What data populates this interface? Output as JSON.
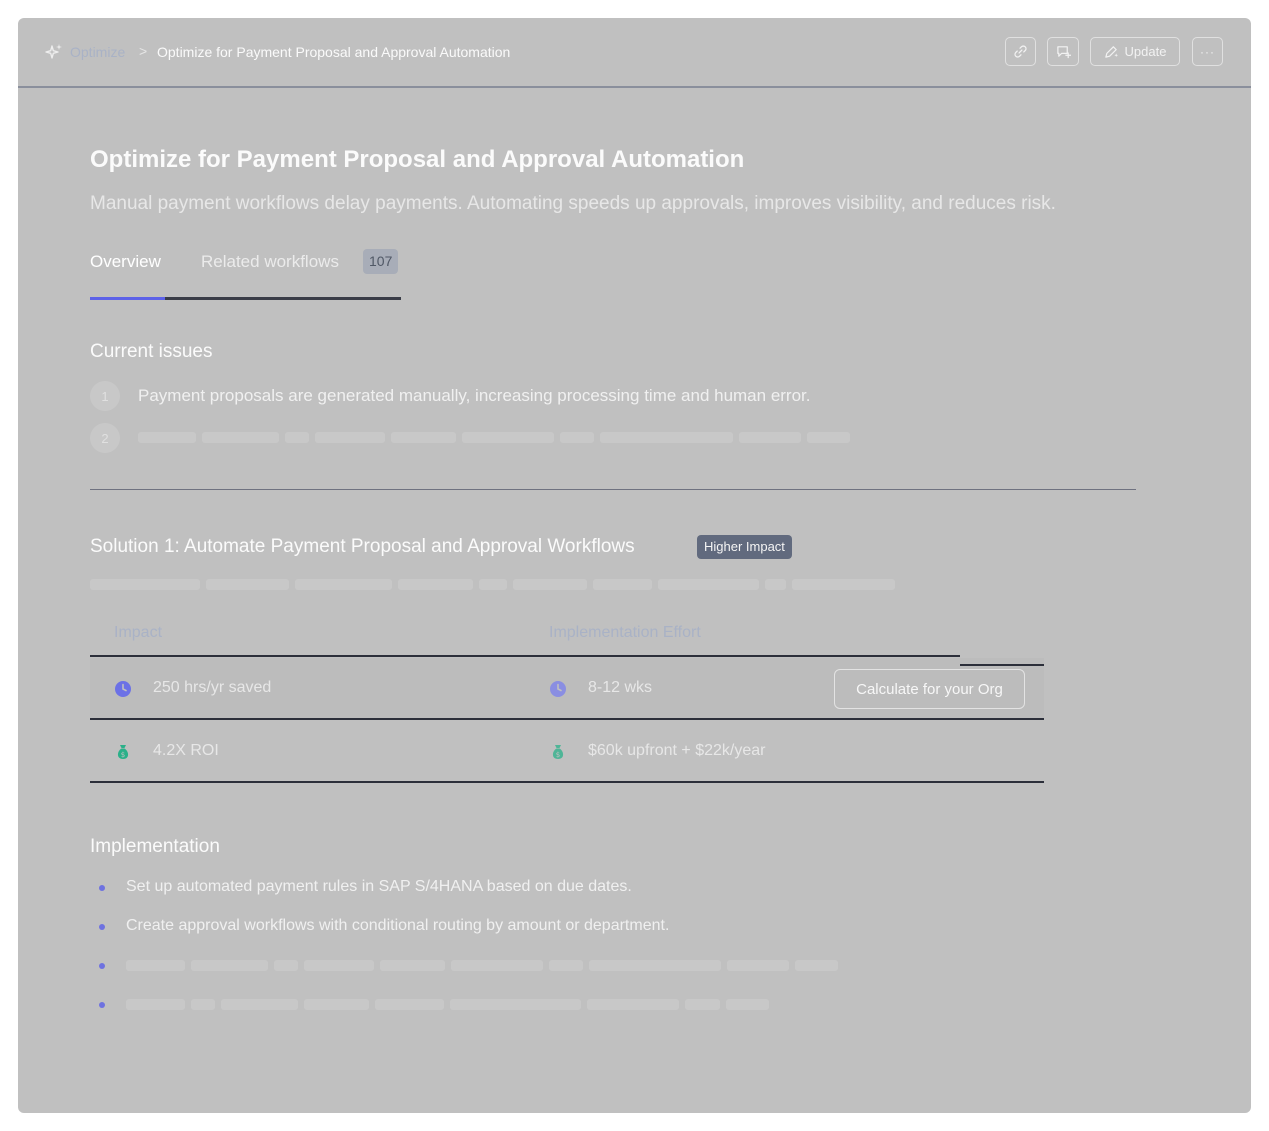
{
  "breadcrumb": {
    "root": "Optimize",
    "separator": ">",
    "current": "Optimize for Payment Proposal and Approval Automation"
  },
  "toolbar": {
    "update_label": "Update",
    "more_label": "···"
  },
  "page": {
    "title": "Optimize for Payment Proposal and Approval Automation",
    "subtitle": "Manual payment workflows delay payments. Automating speeds up approvals, improves visibility, and reduces risk."
  },
  "tabs": [
    {
      "label": "Overview",
      "active": true
    },
    {
      "label": "Related workflows",
      "count": "107"
    }
  ],
  "current_issues": {
    "heading": "Current issues",
    "items": [
      {
        "number": "1",
        "text": "Payment proposals are generated manually, increasing processing time and human error."
      },
      {
        "number": "2",
        "text": ""
      }
    ]
  },
  "solution": {
    "title": "Solution 1: Automate Payment Proposal and Approval Workflows",
    "badge": "Higher Impact",
    "columns": [
      "Impact",
      "Implementation Effort"
    ],
    "rows": [
      {
        "impact": "250 hrs/yr saved",
        "effort": "8-12 wks",
        "impact_icon": "clock-icon",
        "effort_icon": "clock-icon"
      },
      {
        "impact": "4.2X ROI",
        "effort": "$60k upfront + $22k/year",
        "impact_icon": "money-bag-icon",
        "effort_icon": "money-bag-icon"
      }
    ],
    "calculate_label": "Calculate for your Org"
  },
  "implementation": {
    "heading": "Implementation",
    "items": [
      "Set up automated payment rules in SAP S/4HANA based on due dates.",
      "Create approval workflows with conditional routing by amount or department."
    ]
  },
  "colors": {
    "accent": "#5d62e8",
    "clock_icon": "#6c71e6",
    "money_icon": "#2bb089",
    "badge": "#616a7e"
  }
}
